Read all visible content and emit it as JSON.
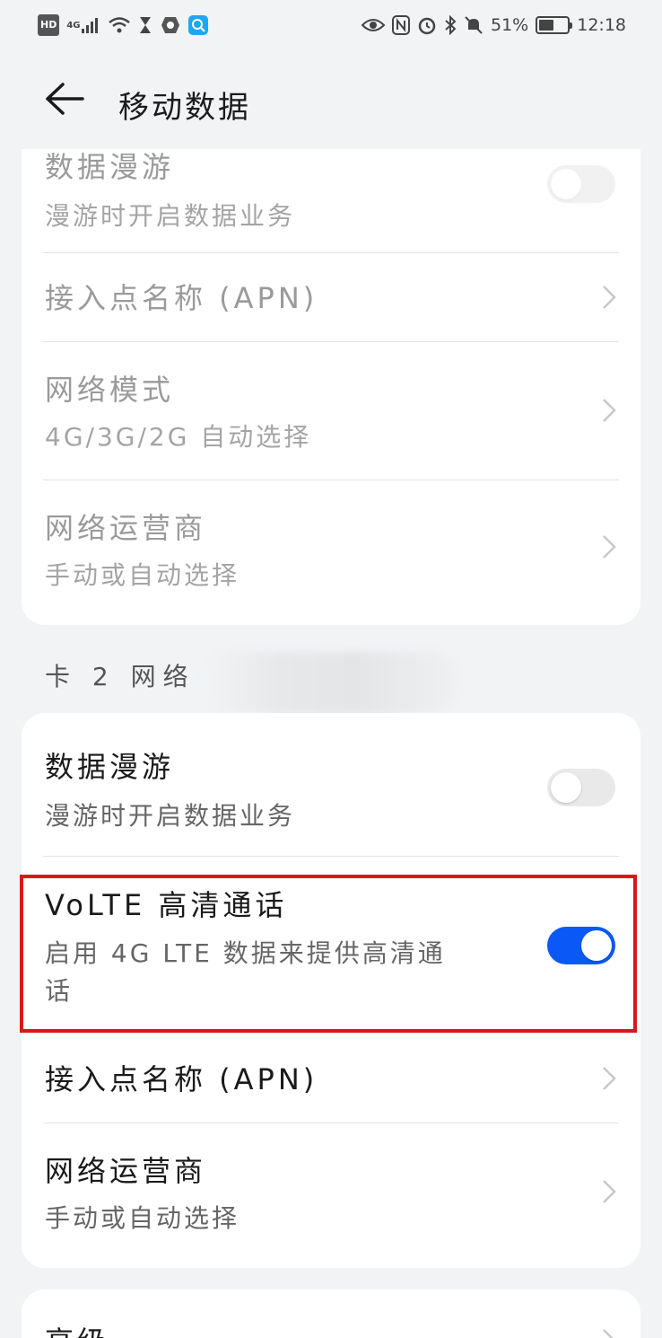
{
  "status_bar": {
    "hd_badge": "HD",
    "signal_label": "4G",
    "battery_text": "51%",
    "battery_level": 0.51,
    "time": "12:18",
    "icons": [
      "hd-icon",
      "cell-signal-icon",
      "wifi-icon",
      "hourglass-icon",
      "app-icon",
      "search-app-icon",
      "eye-icon",
      "nfc-icon",
      "alarm-icon",
      "bluetooth-icon",
      "mute-icon",
      "battery-icon"
    ]
  },
  "header": {
    "title": "移动数据",
    "back_icon": "arrow-left-icon"
  },
  "sim1": {
    "data_roaming": {
      "title": "数据漫游",
      "subtitle": "漫游时开启数据业务",
      "enabled": false
    },
    "apn": {
      "title": "接入点名称 (APN)"
    },
    "network_mode": {
      "title": "网络模式",
      "subtitle": "4G/3G/2G 自动选择"
    },
    "carrier": {
      "title": "网络运营商",
      "subtitle": "手动或自动选择"
    }
  },
  "sim2": {
    "section_label": "卡 2 网络",
    "data_roaming": {
      "title": "数据漫游",
      "subtitle": "漫游时开启数据业务",
      "enabled": false
    },
    "volte": {
      "title": "VoLTE 高清通话",
      "subtitle_line1": "启用 4G LTE 数据来提供高清通",
      "subtitle_line2": "话",
      "enabled": true
    },
    "apn": {
      "title": "接入点名称 (APN)"
    },
    "carrier": {
      "title": "网络运营商",
      "subtitle": "手动或自动选择"
    }
  },
  "advanced": {
    "title": "高级"
  },
  "colors": {
    "accent": "#0a59f7",
    "highlight": "#d91818",
    "background": "#f1f3f5"
  }
}
